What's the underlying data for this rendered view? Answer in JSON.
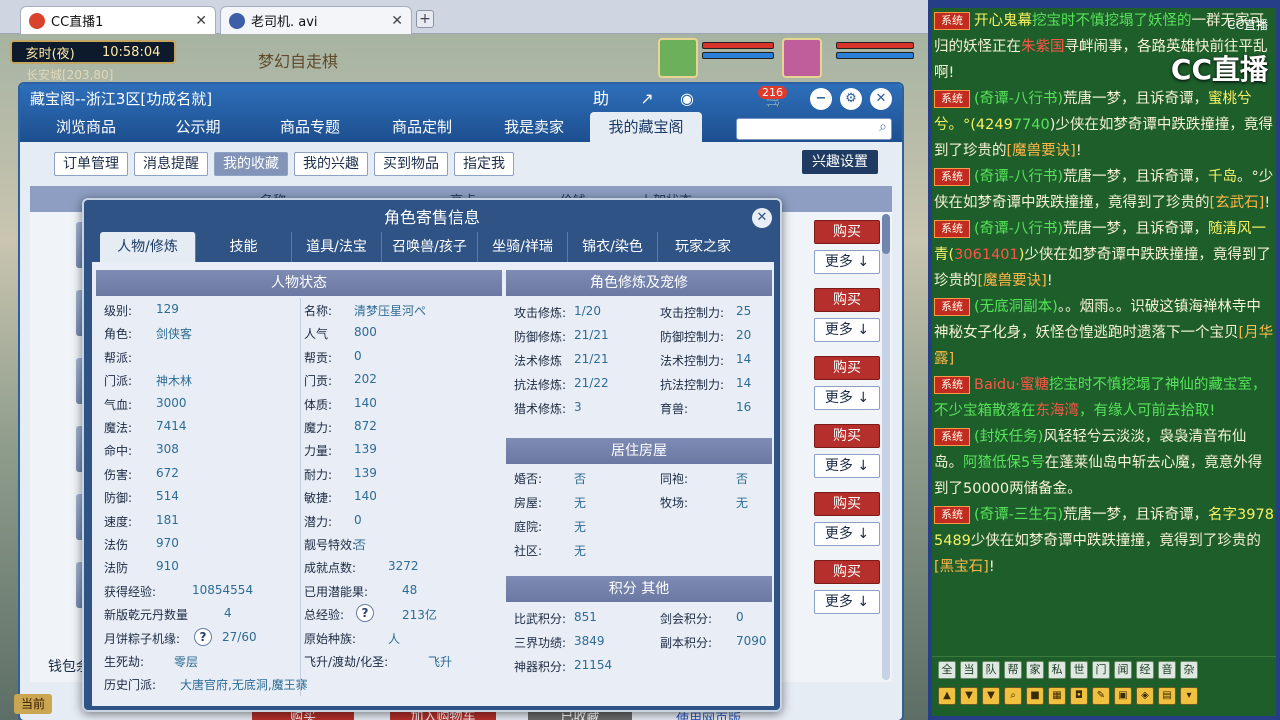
{
  "browser": {
    "tabs": [
      {
        "label": "CC直播1",
        "icon_color": "#d9432b"
      },
      {
        "label": "老司机. avi",
        "icon_color": "#3c5fa8"
      }
    ],
    "close_glyph": "✕",
    "new_tab_glyph": "+"
  },
  "game": {
    "clock_period": "亥时(夜)",
    "clock_time": "10:58:04",
    "coord": "长安城[203,80]",
    "scene_title": "梦幻自走棋",
    "front_label": "当前"
  },
  "store": {
    "title": "藏宝阁--浙江3区[功成名就]",
    "help_label": "助",
    "cart_count": "216",
    "nav_tabs": [
      "浏览商品",
      "公示期",
      "商品专题",
      "商品定制",
      "我是卖家",
      "我的藏宝阁"
    ],
    "active_nav": 5,
    "sub_tabs": [
      "订单管理",
      "消息提醒",
      "我的收藏",
      "我的兴趣",
      "买到物品",
      "指定我"
    ],
    "active_sub": 2,
    "interest_settings": "兴趣设置",
    "list_headers": [
      "名称",
      "亮点",
      "价钱",
      "上架状态"
    ],
    "buy_label": "购买",
    "more_label": "更多 ↓",
    "wallet_label": "钱包余",
    "footer_buttons": [
      "购买",
      "加入购物车",
      "已收藏"
    ],
    "footer_link": "使用网页版",
    "colors": {
      "header": "#2e6fba",
      "buy": "#b5302c",
      "interest_btn": "#1f3b63"
    }
  },
  "modal": {
    "title": "角色寄售信息",
    "tabs": [
      "人物/修炼",
      "技能",
      "道具/法宝",
      "召唤兽/孩子",
      "坐骑/祥瑞",
      "锦衣/染色",
      "玩家之家"
    ],
    "active_tab": 0,
    "status_panel_title": "人物状态",
    "status_left": [
      {
        "label": "级别:",
        "value": "129"
      },
      {
        "label": "角色:",
        "value": "剑侠客"
      },
      {
        "label": "帮派:",
        "value": ""
      },
      {
        "label": "门派:",
        "value": "神木林"
      },
      {
        "label": "气血:",
        "value": "3000"
      },
      {
        "label": "魔法:",
        "value": "7414"
      },
      {
        "label": "命中:",
        "value": "308"
      },
      {
        "label": "伤害:",
        "value": "672"
      },
      {
        "label": "防御:",
        "value": "514"
      },
      {
        "label": "速度:",
        "value": "181"
      },
      {
        "label": "法伤",
        "value": "970"
      },
      {
        "label": "法防",
        "value": "910"
      },
      {
        "label": "获得经验:",
        "value": "10854554"
      },
      {
        "label": "新版乾元丹数量",
        "value": "4"
      },
      {
        "label": "月饼粽子机缘:",
        "value": "27/60"
      },
      {
        "label": "生死劫:",
        "value": "零层"
      },
      {
        "label": "历史门派:",
        "value": "大唐官府,无底洞,魔王寨"
      }
    ],
    "status_right": [
      {
        "label": "名称:",
        "value": "清梦压星河ぺ"
      },
      {
        "label": "人气",
        "value": "800"
      },
      {
        "label": "帮贡:",
        "value": "0"
      },
      {
        "label": "门贡:",
        "value": "202"
      },
      {
        "label": "体质:",
        "value": "140"
      },
      {
        "label": "魔力:",
        "value": "872"
      },
      {
        "label": "力量:",
        "value": "139"
      },
      {
        "label": "耐力:",
        "value": "139"
      },
      {
        "label": "敏捷:",
        "value": "140"
      },
      {
        "label": "潜力:",
        "value": "0"
      },
      {
        "label": "靓号特效:",
        "value": "否"
      },
      {
        "label": "成就点数:",
        "value": "3272"
      },
      {
        "label": "已用潜能果:",
        "value": "48"
      },
      {
        "label": "总经验:",
        "value": "213亿"
      },
      {
        "label": "原始种族:",
        "value": "人"
      },
      {
        "label": "飞升/渡劫/化圣:",
        "value": "飞升"
      }
    ],
    "question_glyph": "?",
    "cultivation_title": "角色修炼及宠修",
    "cultivation": [
      {
        "label": "攻击修炼:",
        "value": "1/20",
        "label2": "攻击控制力:",
        "value2": "25"
      },
      {
        "label": "防御修炼:",
        "value": "21/21",
        "label2": "防御控制力:",
        "value2": "20"
      },
      {
        "label": "法术修炼",
        "value": "21/21",
        "label2": "法术控制力:",
        "value2": "14"
      },
      {
        "label": "抗法修炼:",
        "value": "21/22",
        "label2": "抗法控制力:",
        "value2": "14"
      },
      {
        "label": "猎术修炼:",
        "value": "3",
        "label2": "育兽:",
        "value2": "16"
      }
    ],
    "house_title": "居住房屋",
    "house": [
      {
        "label": "婚否:",
        "value": "否",
        "label2": "同袍:",
        "value2": "否"
      },
      {
        "label": "房屋:",
        "value": "无",
        "label2": "牧场:",
        "value2": "无"
      },
      {
        "label": "庭院:",
        "value": "无",
        "label2": "",
        "value2": ""
      },
      {
        "label": "社区:",
        "value": "无",
        "label2": "",
        "value2": ""
      }
    ],
    "score_title": "积分 其他",
    "score": [
      {
        "label": "比武积分:",
        "value": "851",
        "label2": "剑会积分:",
        "value2": "0"
      },
      {
        "label": "三界功绩:",
        "value": "3849",
        "label2": "副本积分:",
        "value2": "7090"
      },
      {
        "label": "神器积分:",
        "value": "21154",
        "label2": "",
        "value2": ""
      }
    ]
  },
  "chat": {
    "watermark": "CC直播",
    "watermark_small": "CC直播",
    "sys_tag": "系统",
    "messages": [
      {
        "parts": [
          [
            "y",
            "开心鬼幕"
          ],
          [
            "g",
            "挖宝时不慎挖塌了妖怪的"
          ],
          [
            "",
            "一群无家可归的妖怪正在"
          ],
          [
            "r",
            "朱紫国"
          ],
          [
            "",
            "寻衅闹事，各路英雄快前往平乱啊!"
          ]
        ]
      },
      {
        "parts": [
          [
            "g",
            "(奇谭-八行书)"
          ],
          [
            "",
            "荒唐一梦，且诉奇谭，"
          ],
          [
            "y",
            "蜜桃兮兮。°(4249"
          ],
          [
            "g",
            "7740"
          ],
          [
            "",
            ")少侠在如梦奇谭中跌跌撞撞，竟得到了珍贵的"
          ],
          [
            "o",
            "[魔兽要诀]"
          ],
          [
            "",
            "!"
          ]
        ]
      },
      {
        "parts": [
          [
            "g",
            "(奇谭-八行书)"
          ],
          [
            "",
            "荒唐一梦，且诉奇谭，"
          ],
          [
            "y",
            "千岛"
          ],
          [
            "",
            "。°少侠在如梦奇谭中跌跌撞撞，竟得到了珍贵的"
          ],
          [
            "o",
            "[玄武石]"
          ],
          [
            "",
            "!"
          ]
        ]
      },
      {
        "parts": [
          [
            "g",
            "(奇谭-八行书)"
          ],
          [
            "",
            "荒唐一梦，且诉奇谭，"
          ],
          [
            "y",
            "随清风一青("
          ],
          [
            "r",
            "3061401"
          ],
          [
            "y",
            ")"
          ],
          [
            "",
            "少侠在如梦奇谭中跌跌撞撞，竟得到了珍贵的"
          ],
          [
            "o",
            "[魔兽要诀]"
          ],
          [
            "",
            "!"
          ]
        ]
      },
      {
        "parts": [
          [
            "g",
            "(无底洞副本)"
          ],
          [
            "",
            "。。烟雨。。识破这镇海禅林寺中神秘女子化身，妖怪仓惶逃跑时遗落下一个宝贝"
          ],
          [
            "o",
            "[月华露]"
          ]
        ]
      },
      {
        "parts": [
          [
            "r",
            "Baidu·蜜糖"
          ],
          [
            "g",
            "挖宝时不慎挖塌了神仙的藏宝室，不少宝箱散落在"
          ],
          [
            "r",
            "东海湾"
          ],
          [
            "g",
            "，有缘人可前去拾取!"
          ]
        ]
      },
      {
        "parts": [
          [
            "g",
            "(封妖任务)"
          ],
          [
            "",
            "风轻轻兮云淡淡，袅袅清音布仙岛。"
          ],
          [
            "g",
            "阿猹低保5号"
          ],
          [
            "",
            "在蓬莱仙岛中斩去心魔，竟意外得到了50000两储备金。"
          ]
        ]
      },
      {
        "parts": [
          [
            "g",
            "(奇谭-三生石)"
          ],
          [
            "",
            "荒唐一梦，且诉奇谭，"
          ],
          [
            "y",
            "名字39785489"
          ],
          [
            "",
            "少侠在如梦奇谭中跌跌撞撞，竟得到了珍贵的"
          ],
          [
            "o",
            "[黑宝石]"
          ],
          [
            "",
            "!"
          ]
        ]
      }
    ],
    "channels": [
      "全",
      "当",
      "队",
      "帮",
      "家",
      "私",
      "世",
      "门",
      "闻",
      "经",
      "音",
      "杂"
    ]
  }
}
